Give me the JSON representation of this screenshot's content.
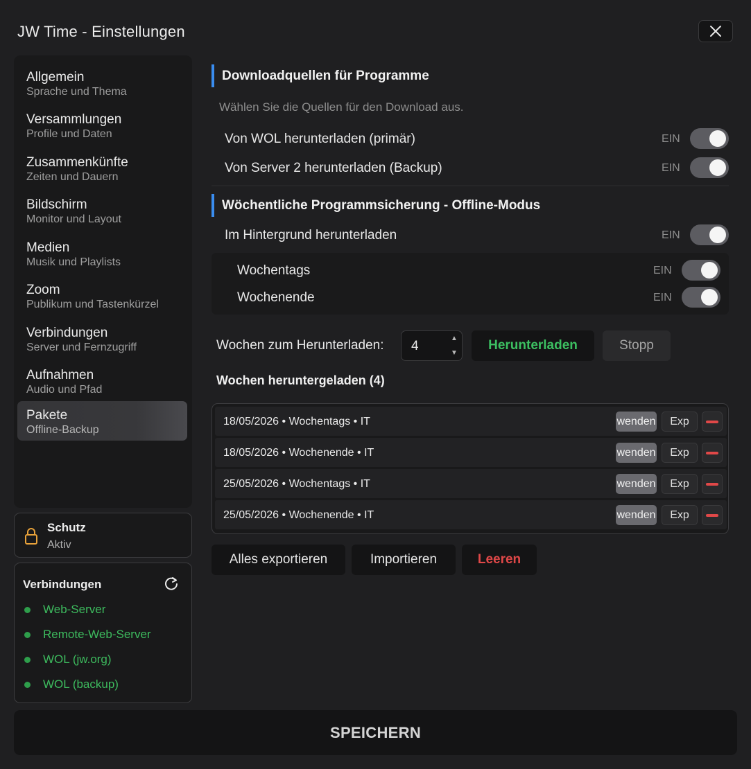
{
  "window": {
    "title": "JW Time - Einstellungen"
  },
  "sidebar": {
    "items": [
      {
        "title": "Allgemein",
        "subtitle": "Sprache und Thema"
      },
      {
        "title": "Versammlungen",
        "subtitle": "Profile und Daten"
      },
      {
        "title": "Zusammenkünfte",
        "subtitle": "Zeiten und Dauern"
      },
      {
        "title": "Bildschirm",
        "subtitle": "Monitor und Layout"
      },
      {
        "title": "Medien",
        "subtitle": "Musik und Playlists"
      },
      {
        "title": "Zoom",
        "subtitle": "Publikum und Tastenkürzel"
      },
      {
        "title": "Verbindungen",
        "subtitle": "Server und Fernzugriff"
      },
      {
        "title": "Aufnahmen",
        "subtitle": "Audio und Pfad"
      },
      {
        "title": "Pakete",
        "subtitle": "Offline-Backup"
      }
    ],
    "active": "Pakete"
  },
  "protection": {
    "title": "Schutz",
    "status": "Aktiv"
  },
  "connections": {
    "title": "Verbindungen",
    "items": [
      "Web-Server",
      "Remote-Web-Server",
      "WOL (jw.org)",
      "WOL (backup)"
    ],
    "status_color": "#3dbb5e"
  },
  "sources": {
    "heading": "Downloadquellen für Programme",
    "hint": "Wählen Sie die Quellen für den Download aus.",
    "rows": [
      {
        "label": "Von WOL herunterladen (primär)",
        "state": "EIN"
      },
      {
        "label": "Von Server 2 herunterladen (Backup)",
        "state": "EIN"
      }
    ]
  },
  "weekly": {
    "heading": "Wöchentliche Programmsicherung - Offline-Modus",
    "background": {
      "label": "Im Hintergrund herunterladen",
      "state": "EIN"
    },
    "sub": [
      {
        "label": "Wochentags",
        "state": "EIN"
      },
      {
        "label": "Wochenende",
        "state": "EIN"
      }
    ],
    "weeks_label": "Wochen zum Herunterladen:",
    "weeks_value": "4",
    "download_button": "Herunterladen",
    "stop_button": "Stopp"
  },
  "downloaded": {
    "title": "Wochen heruntergeladen (4)",
    "rows": [
      {
        "label": "18/05/2026 • Wochentags • IT",
        "use": "wenden",
        "export": "Exp"
      },
      {
        "label": "18/05/2026 • Wochenende • IT",
        "use": "wenden",
        "export": "Exp"
      },
      {
        "label": "25/05/2026 • Wochentags • IT",
        "use": "wenden",
        "export": "Exp"
      },
      {
        "label": "25/05/2026 • Wochenende • IT",
        "use": "wenden",
        "export": "Exp"
      }
    ]
  },
  "actions": {
    "export_all": "Alles exportieren",
    "import": "Importieren",
    "clear": "Leeren"
  },
  "footer": {
    "save": "SPEICHERN"
  },
  "colors": {
    "accent": "#3a8df0",
    "success": "#3cc061",
    "danger": "#e04848"
  }
}
